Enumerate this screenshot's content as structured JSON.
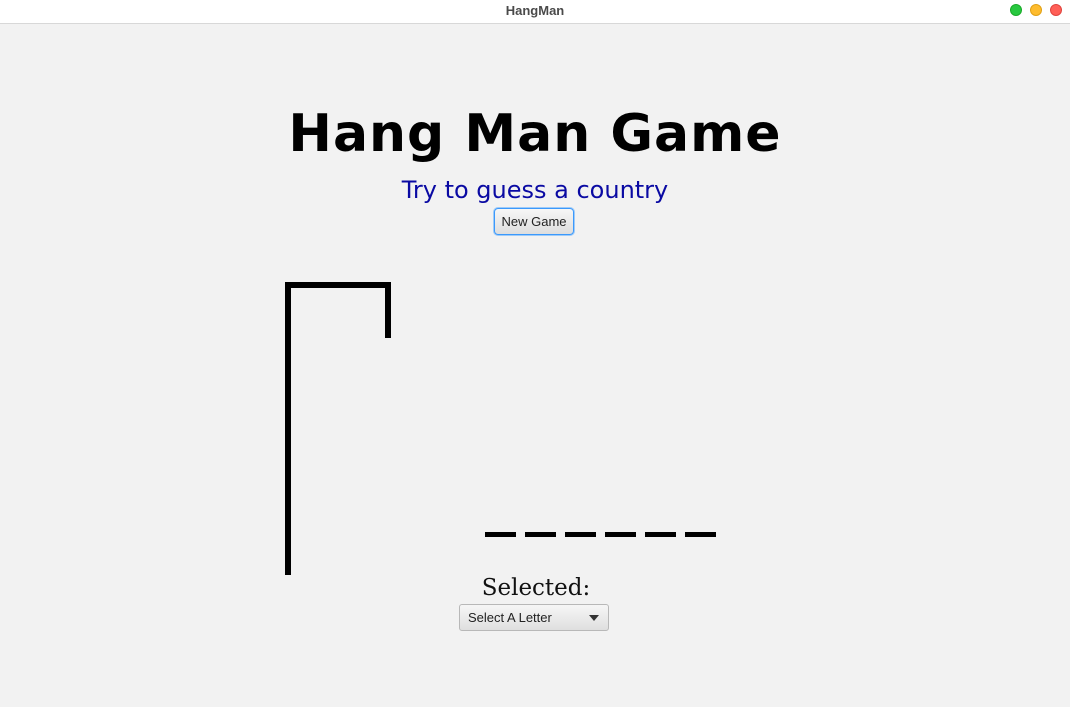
{
  "window": {
    "title": "HangMan"
  },
  "header": {
    "title": "Hang Man Game",
    "subtitle": "Try to guess a country",
    "new_game_label": "New Game"
  },
  "word": {
    "blank_count": 6
  },
  "selection": {
    "label": "Selected:",
    "dropdown_value": "Select A Letter"
  },
  "colors": {
    "subtitle": "#0a0aa3",
    "background": "#f2f2f2",
    "button_focus": "#3b99fc"
  },
  "icons": {
    "dropdown": "chevron-down-icon"
  }
}
